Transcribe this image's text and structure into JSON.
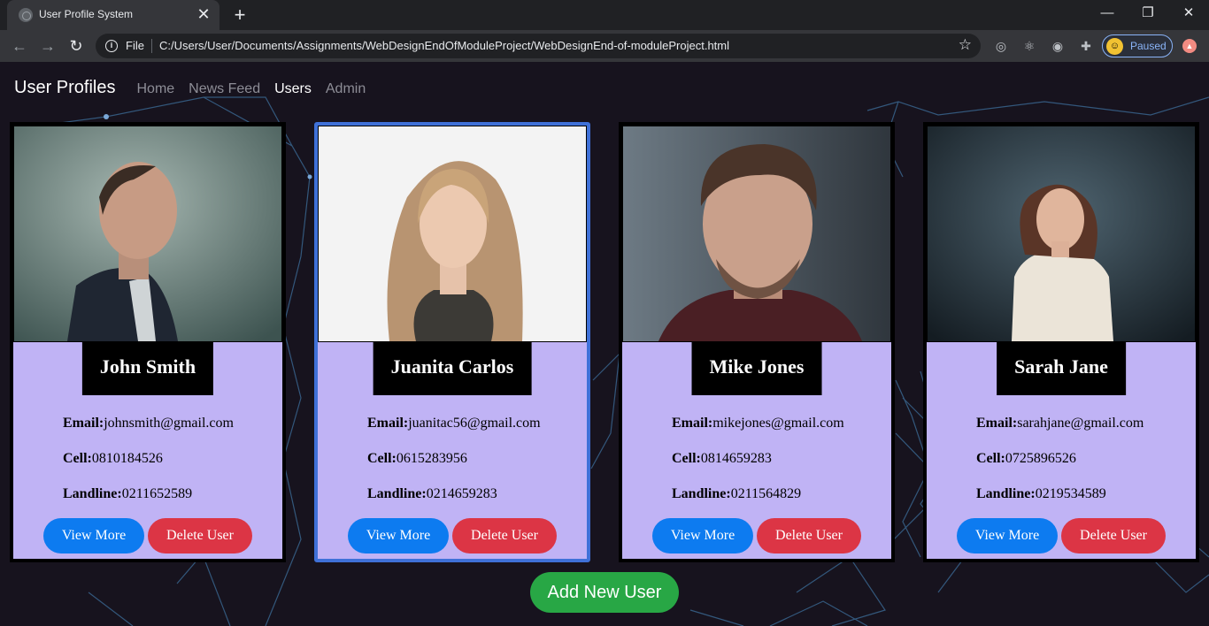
{
  "browser": {
    "tab_title": "User Profile System",
    "tab_close": "✕",
    "new_tab": "+",
    "controls": {
      "minimize": "—",
      "restore": "❐",
      "close": "✕"
    },
    "scheme_label": "File",
    "url": "C:/Users/User/Documents/Assignments/WebDesignEndOfModuleProject/WebDesignEnd-of-moduleProject.html",
    "profile_status": "Paused"
  },
  "navbar": {
    "brand": "User Profiles",
    "links": [
      {
        "label": "Home",
        "active": false
      },
      {
        "label": "News Feed",
        "active": false
      },
      {
        "label": "Users",
        "active": true
      },
      {
        "label": "Admin",
        "active": false
      }
    ]
  },
  "labels": {
    "email": "Email:",
    "cell": "Cell:",
    "landline": "Landline:",
    "view_more": "View More",
    "delete_user": "Delete User",
    "add_new_user": "Add New User"
  },
  "users": [
    {
      "name": "John Smith",
      "email": "johnsmith@gmail.com",
      "cell": "0810184526",
      "landline": "0211652589",
      "selected": false
    },
    {
      "name": "Juanita Carlos",
      "email": "juanitac56@gmail.com",
      "cell": "0615283956",
      "landline": "0214659283",
      "selected": true
    },
    {
      "name": "Mike Jones",
      "email": "mikejones@gmail.com",
      "cell": "0814659283",
      "landline": "0211564829",
      "selected": false
    },
    {
      "name": "Sarah Jane",
      "email": "sarahjane@gmail.com",
      "cell": "0725896526",
      "landline": "0219534589",
      "selected": false
    }
  ],
  "colors": {
    "page_bg": "#17131e",
    "card_panel": "#c0b3f5",
    "selected_border": "#3f71d8",
    "view_button": "#0d7bf0",
    "delete_button": "#dc3545",
    "add_button": "#28a745"
  }
}
